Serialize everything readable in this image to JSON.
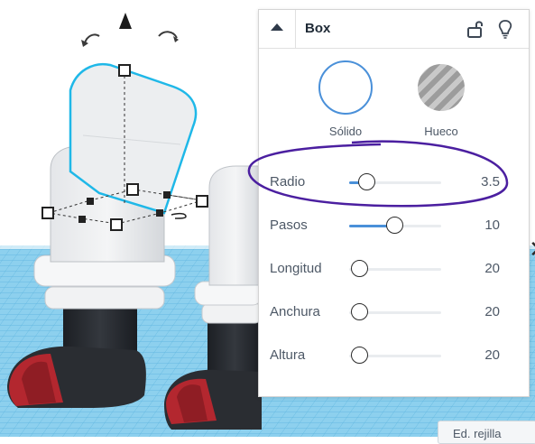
{
  "panel": {
    "title": "Box",
    "shape_options": [
      {
        "label": "Sólido"
      },
      {
        "label": "Hueco"
      }
    ],
    "properties": [
      {
        "label": "Radio",
        "value": "3.5",
        "level": 0.2
      },
      {
        "label": "Pasos",
        "value": "10",
        "level": 0.5
      },
      {
        "label": "Longitud",
        "value": "20",
        "level": 0.12
      },
      {
        "label": "Anchura",
        "value": "20",
        "level": 0.12
      },
      {
        "label": "Altura",
        "value": "20",
        "level": 0.12
      }
    ]
  },
  "toolbar": {
    "grid_button_label": "Ed. rejilla"
  },
  "colors": {
    "accent": "#4a90d9",
    "annotation": "#4b1fa0",
    "workplane": "#7ec7ea",
    "selection": "#1fb8e8",
    "shoe_red": "#b3272f",
    "shoe_black": "#2a2d32"
  },
  "icons": {
    "collapse": "triangle-up-icon",
    "lock": "lock-open-icon",
    "light": "lightbulb-icon",
    "rotate": "rotate-arrow-icon",
    "lift": "cone-lift-icon"
  }
}
